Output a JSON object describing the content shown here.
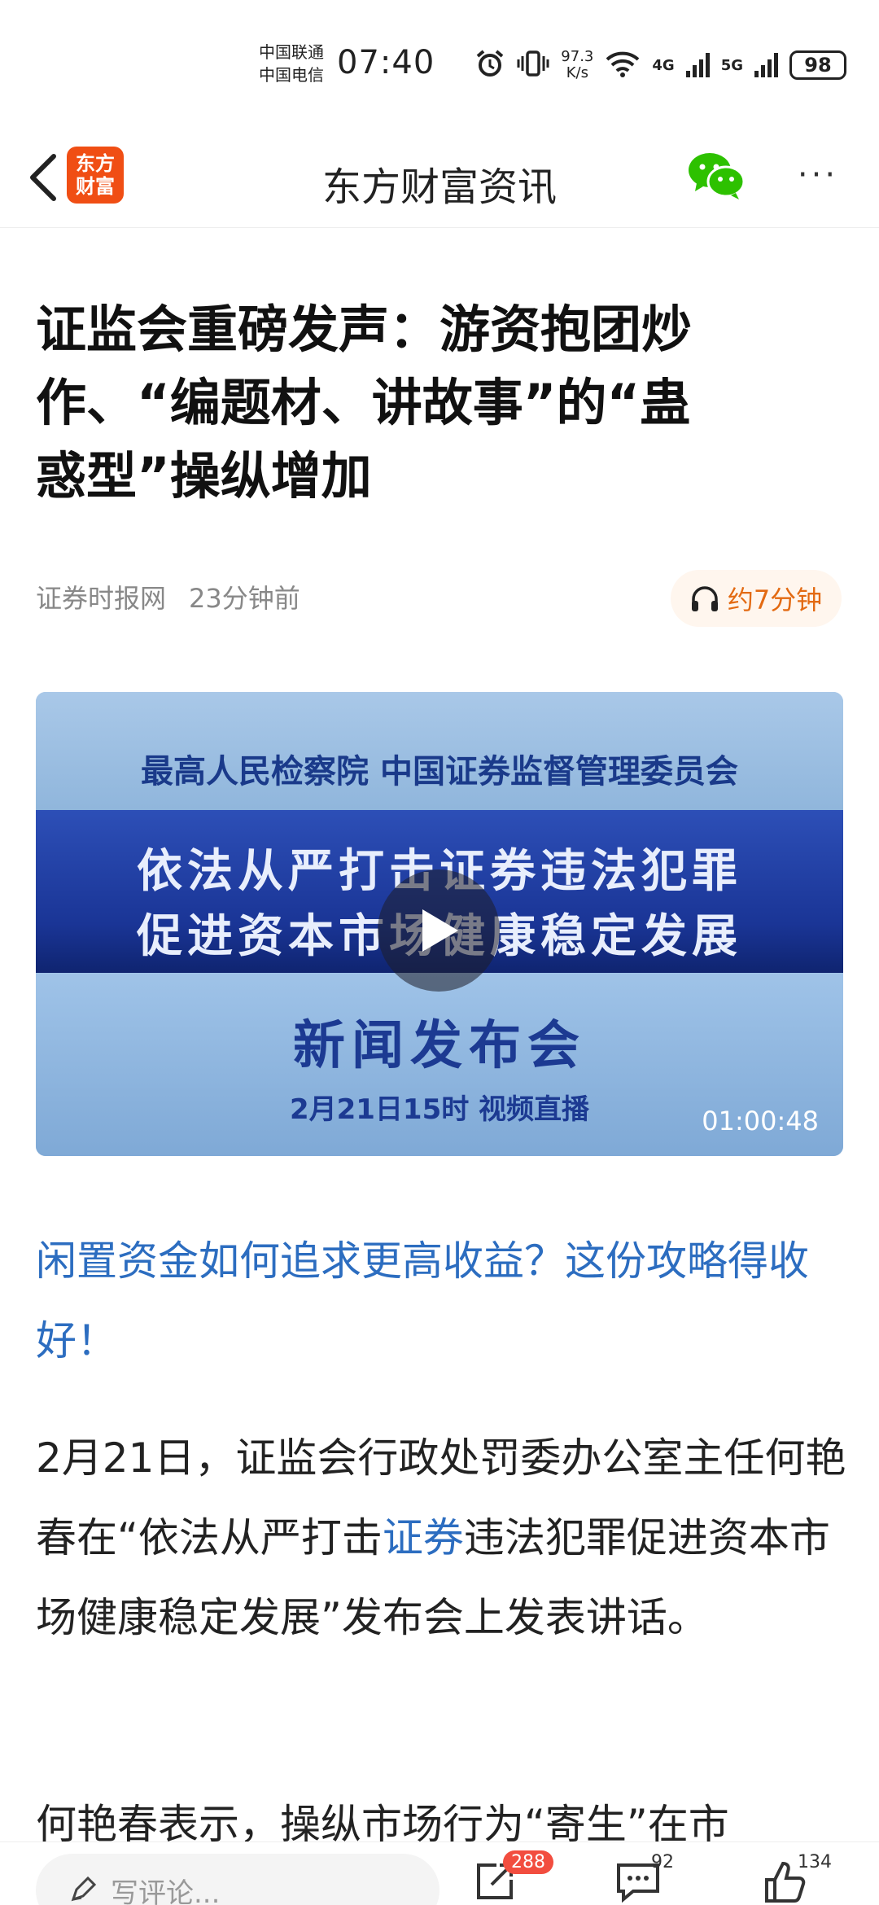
{
  "status_bar": {
    "carrier_1": "中国联通",
    "carrier_2": "中国电信",
    "time": "07:40",
    "net_speed_value": "97.3",
    "net_speed_unit": "K/s",
    "net_4g": "4G",
    "net_5g": "5G",
    "battery": "98"
  },
  "header": {
    "logo_text_1": "东方",
    "logo_text_2": "财富",
    "title": "东方财富资讯",
    "more_label": "···"
  },
  "article": {
    "headline_line_1": "证监会重磅发声：游资抱团炒",
    "headline_line_2": "作、“编题材、讲故事”的“蛊",
    "headline_line_3": "惑型”操纵增加",
    "source": "证券时报网",
    "published": "23分钟前",
    "listen_label": "约7分钟",
    "video": {
      "top_text": "最高人民检察院  中国证券监督管理委员会",
      "band_line_1": "依法从严打击证券违法犯罪",
      "band_line_2": "促进资本市场健康稳定发展",
      "press_text": "新闻发布会",
      "date_text": "2月21日15时 视频直播",
      "duration": "01:00:48"
    },
    "promo_link": "闲置资金如何追求更高收益？这份攻略得收好！",
    "p1_part_1": "2月21日，证监会行政处罚委办公室主任何艳春在“依法从严打击",
    "p1_keyword": "证券",
    "p1_part_2": "违法犯罪促进资本市场健康稳定发展”发布会上发表讲话。",
    "p2": "何艳春表示，操纵市场行为“寄生”在市"
  },
  "bottom_bar": {
    "comment_placeholder": "写评论...",
    "share_count": "288",
    "comment_count": "92",
    "like_count": "134"
  },
  "colors": {
    "brand_orange": "#f04e14",
    "link_blue": "#2c6dc0",
    "badge_red": "#f24d3f",
    "listen_orange": "#e36a12"
  }
}
